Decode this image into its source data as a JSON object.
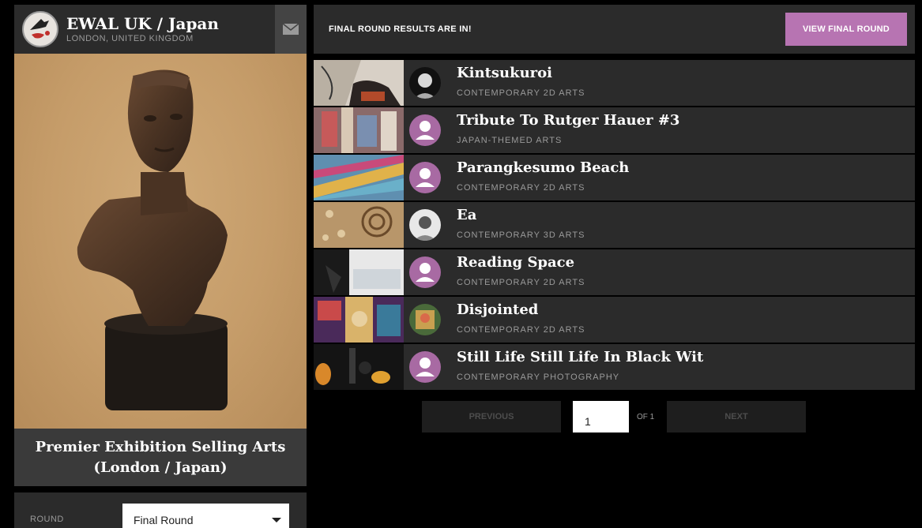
{
  "organization": {
    "name": "EWAL UK / Japan",
    "location": "LONDON, UNITED KINGDOM",
    "icons": {
      "logo": "ewal-logo-icon",
      "mail": "mail-icon"
    }
  },
  "exhibition": {
    "title_line1": "Premier Exhibition Selling Arts",
    "title_line2": "(London / Japan)"
  },
  "round": {
    "label": "ROUND",
    "selected": "Final Round"
  },
  "banner": {
    "message": "FINAL ROUND RESULTS ARE IN!",
    "button_label": "VIEW FINAL ROUND",
    "button_color": "#b774b2"
  },
  "entries": [
    {
      "title": "Kintsukuroi",
      "category": "CONTEMPORARY 2D ARTS",
      "avatar": "photo"
    },
    {
      "title": "Tribute To Rutger Hauer #3",
      "category": "JAPAN-THEMED ARTS",
      "avatar": "default"
    },
    {
      "title": "Parangkesumo Beach",
      "category": "CONTEMPORARY 2D ARTS",
      "avatar": "default"
    },
    {
      "title": "Ea",
      "category": "CONTEMPORARY 3D ARTS",
      "avatar": "photo"
    },
    {
      "title": "Reading Space",
      "category": "CONTEMPORARY 2D ARTS",
      "avatar": "default"
    },
    {
      "title": "Disjointed",
      "category": "CONTEMPORARY 2D ARTS",
      "avatar": "photo"
    },
    {
      "title": "Still Life Still Life In Black Wit",
      "category": "CONTEMPORARY PHOTOGRAPHY",
      "avatar": "default"
    }
  ],
  "pagination": {
    "previous_label": "PREVIOUS",
    "next_label": "NEXT",
    "current_page": "1",
    "of_label": "OF 1"
  }
}
